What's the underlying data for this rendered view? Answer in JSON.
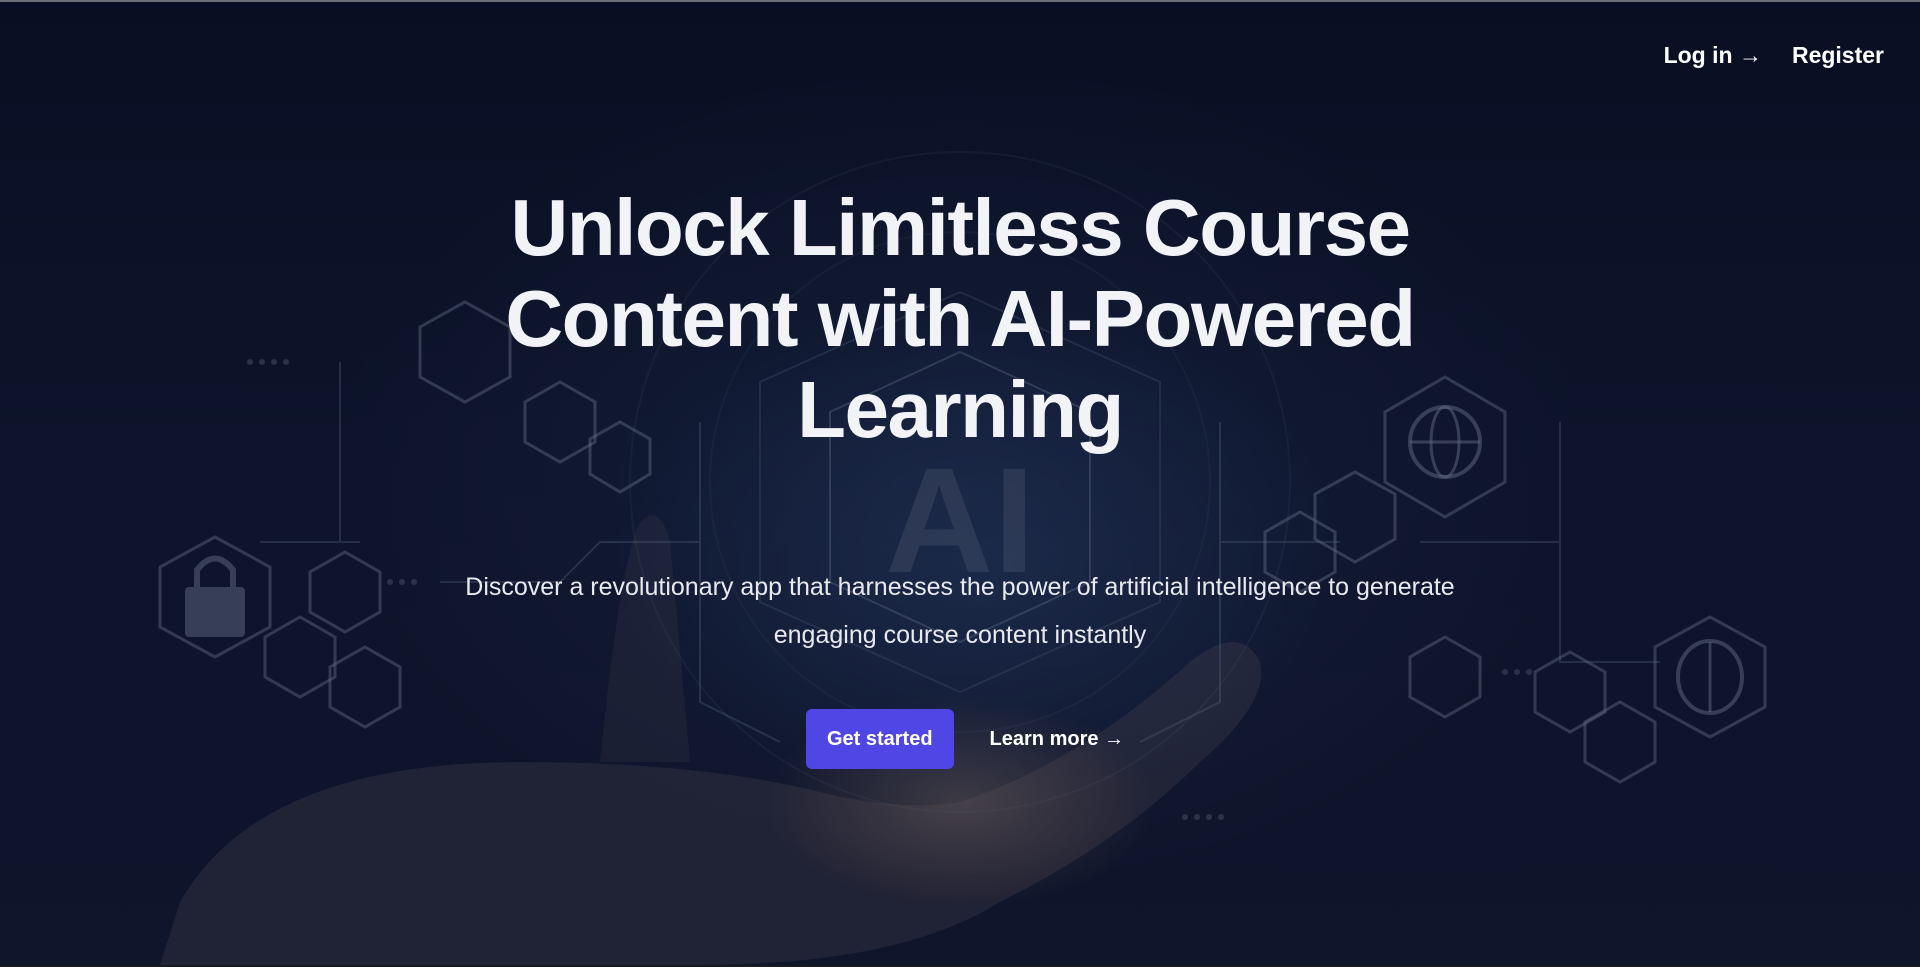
{
  "nav": {
    "login_label": "Log in →",
    "register_label": "Register"
  },
  "hero": {
    "headline": "Unlock Limitless Course Content with AI-Powered Learning",
    "subtext": "Discover a revolutionary app that harnesses the power of artificial intelligence to generate engaging course content instantly",
    "primary_cta": "Get started",
    "secondary_cta": "Learn more →",
    "background_art_text": "AI"
  },
  "colors": {
    "background": "#0b1226",
    "primary_button": "#4f46e5",
    "text": "#f2f3f7"
  },
  "icons": [
    "lock-icon",
    "globe-icon",
    "gear-icon",
    "brain-icon",
    "bar-chart-icon",
    "shield-icon",
    "target-icon",
    "lightbulb-icon",
    "handshake-icon",
    "search-icon"
  ]
}
